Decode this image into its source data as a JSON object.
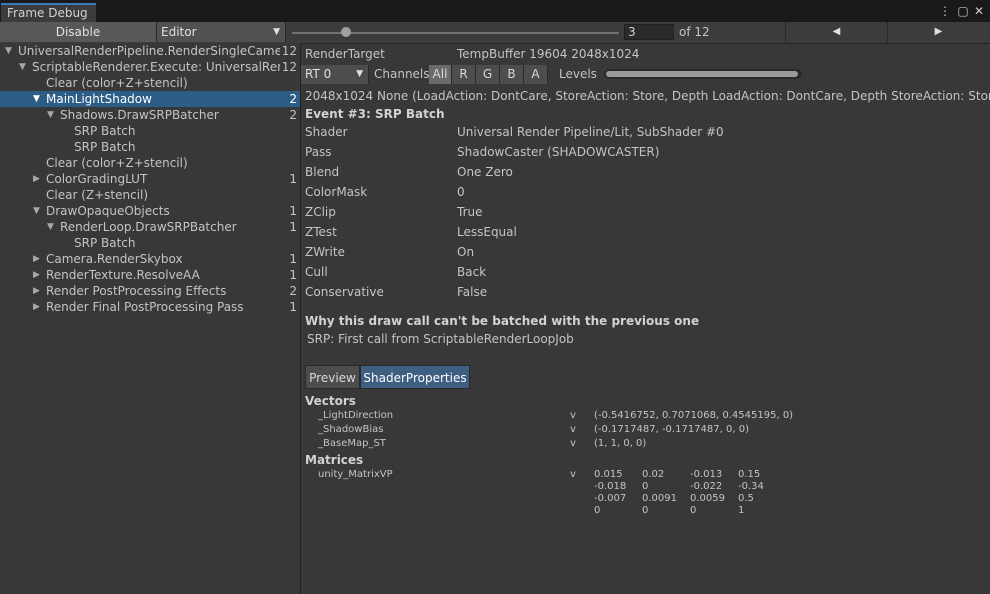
{
  "window": {
    "tab_title": "Frame Debug"
  },
  "toolbar": {
    "disable_label": "Disable",
    "target_dropdown": "Editor",
    "frame_value": "3",
    "frame_total_label": "of 12",
    "prev_icon": "◀",
    "next_icon": "▶"
  },
  "slider": {
    "current": 3,
    "total": 12
  },
  "tree": [
    {
      "label": "UniversalRenderPipeline.RenderSingleCamera: Main",
      "count": "12",
      "expand": "open"
    },
    {
      "label": "ScriptableRenderer.Execute: UniversalRenderer",
      "count": "12",
      "expand": "open"
    },
    {
      "label": "Clear (color+Z+stencil)",
      "count": "",
      "expand": "none"
    },
    {
      "label": "MainLightShadow",
      "count": "2",
      "expand": "open"
    },
    {
      "label": "Shadows.DrawSRPBatcher",
      "count": "2",
      "expand": "open"
    },
    {
      "label": "SRP Batch",
      "count": "",
      "expand": "none"
    },
    {
      "label": "SRP Batch",
      "count": "",
      "expand": "none"
    },
    {
      "label": "Clear (color+Z+stencil)",
      "count": "",
      "expand": "none"
    },
    {
      "label": "ColorGradingLUT",
      "count": "1",
      "expand": "closed"
    },
    {
      "label": "Clear (Z+stencil)",
      "count": "",
      "expand": "none"
    },
    {
      "label": "DrawOpaqueObjects",
      "count": "1",
      "expand": "open"
    },
    {
      "label": "RenderLoop.DrawSRPBatcher",
      "count": "1",
      "expand": "open"
    },
    {
      "label": "SRP Batch",
      "count": "",
      "expand": "none"
    },
    {
      "label": "Camera.RenderSkybox",
      "count": "1",
      "expand": "closed"
    },
    {
      "label": "RenderTexture.ResolveAA",
      "count": "1",
      "expand": "closed"
    },
    {
      "label": "Render PostProcessing Effects",
      "count": "2",
      "expand": "closed"
    },
    {
      "label": "Render Final PostProcessing Pass",
      "count": "1",
      "expand": "closed"
    }
  ],
  "render_target": {
    "label": "RenderTarget",
    "value": "TempBuffer 19604 2048x1024",
    "rt_select": "RT 0",
    "channels_label": "Channels",
    "channels": [
      "All",
      "R",
      "G",
      "B",
      "A"
    ],
    "levels_label": "Levels",
    "levels_range": [
      0,
      1
    ]
  },
  "event": {
    "info_line": "2048x1024 None (LoadAction: DontCare, StoreAction: Store, Depth LoadAction: DontCare, Depth StoreAction: Store)",
    "title": "Event #3: SRP Batch",
    "properties": [
      {
        "name": "Shader",
        "value": "Universal Render Pipeline/Lit, SubShader #0"
      },
      {
        "name": "Pass",
        "value": "ShadowCaster (SHADOWCASTER)"
      },
      {
        "name": "Blend",
        "value": "One Zero"
      },
      {
        "name": "ColorMask",
        "value": "0"
      },
      {
        "name": "ZClip",
        "value": "True"
      },
      {
        "name": "ZTest",
        "value": "LessEqual"
      },
      {
        "name": "ZWrite",
        "value": "On"
      },
      {
        "name": "Cull",
        "value": "Back"
      },
      {
        "name": "Conservative",
        "value": "False"
      }
    ],
    "batch_heading": "Why this draw call can't be batched with the previous one",
    "batch_reason": "SRP: First call from ScriptableRenderLoopJob"
  },
  "tabs": {
    "preview": "Preview",
    "shader_properties": "ShaderProperties"
  },
  "vectors": {
    "heading": "Vectors",
    "items": [
      {
        "name": "_LightDirection",
        "stage": "v",
        "value": "(-0.5416752, 0.7071068, 0.4545195, 0)"
      },
      {
        "name": "_ShadowBias",
        "stage": "v",
        "value": "(-0.1717487, -0.1717487, 0, 0)"
      },
      {
        "name": "_BaseMap_ST",
        "stage": "v",
        "value": "(1, 1, 0, 0)"
      }
    ]
  },
  "matrices": {
    "heading": "Matrices",
    "items": [
      {
        "name": "unity_MatrixVP",
        "stage": "v",
        "rows": [
          [
            "0.015",
            "0.02",
            "-0.013",
            "0.15"
          ],
          [
            "-0.018",
            "0",
            "-0.022",
            "-0.34"
          ],
          [
            "-0.007",
            "0.0091",
            "0.0059",
            "0.5"
          ],
          [
            "0",
            "0",
            "0",
            "1"
          ]
        ]
      }
    ]
  }
}
